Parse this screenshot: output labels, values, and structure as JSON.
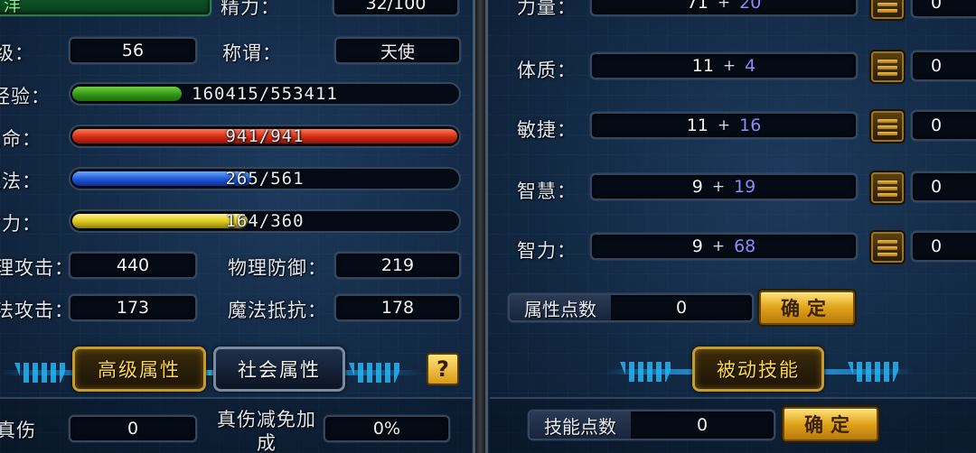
{
  "left": {
    "top_partial_value": "洋",
    "energy_label": "精力：",
    "energy_value": "32/100",
    "row1_label": "级：",
    "row1_value": "56",
    "title_label": "称谓：",
    "title_value": "天使",
    "bars": [
      {
        "label": "经验：",
        "text": "160415/553411",
        "fill": 0.29,
        "color": "green"
      },
      {
        "label": "生命：",
        "text": "941/941",
        "fill": 1.0,
        "color": "red"
      },
      {
        "label": "魔法：",
        "text": "265/561",
        "fill": 0.47,
        "color": "blue"
      },
      {
        "label": "耐力：",
        "text": "164/360",
        "fill": 0.46,
        "color": "yellow"
      }
    ],
    "phys_atk_label": "理攻击：",
    "phys_atk_value": "440",
    "phys_def_label": "物理防御：",
    "phys_def_value": "219",
    "mag_atk_label": "法攻击：",
    "mag_atk_value": "173",
    "mag_res_label": "魔法抵抗：",
    "mag_res_value": "178",
    "tab_advanced": "高级属性",
    "tab_social": "社会属性",
    "help_icon_text": "?",
    "true_dmg_label": "真伤",
    "true_dmg_value": "0",
    "true_dmg_reduce_label": "真伤减免加成",
    "true_dmg_reduce_value": "0%"
  },
  "right": {
    "attributes": [
      {
        "label": "力量：",
        "base": "71",
        "bonus": "20",
        "points": "0"
      },
      {
        "label": "体质：",
        "base": "11",
        "bonus": "4",
        "points": "0"
      },
      {
        "label": "敏捷：",
        "base": "11",
        "bonus": "16",
        "points": "0"
      },
      {
        "label": "智慧：",
        "base": "9",
        "bonus": "19",
        "points": "0"
      },
      {
        "label": "智力：",
        "base": "9",
        "bonus": "68",
        "points": "0"
      }
    ],
    "plus_sign": "+",
    "attr_points_label": "属性点数",
    "attr_points_value": "0",
    "confirm_label": "确定",
    "passive_skill_tab": "被动技能",
    "skill_points_label": "技能点数",
    "skill_points_value": "0",
    "skill_confirm_label": "确定"
  }
}
